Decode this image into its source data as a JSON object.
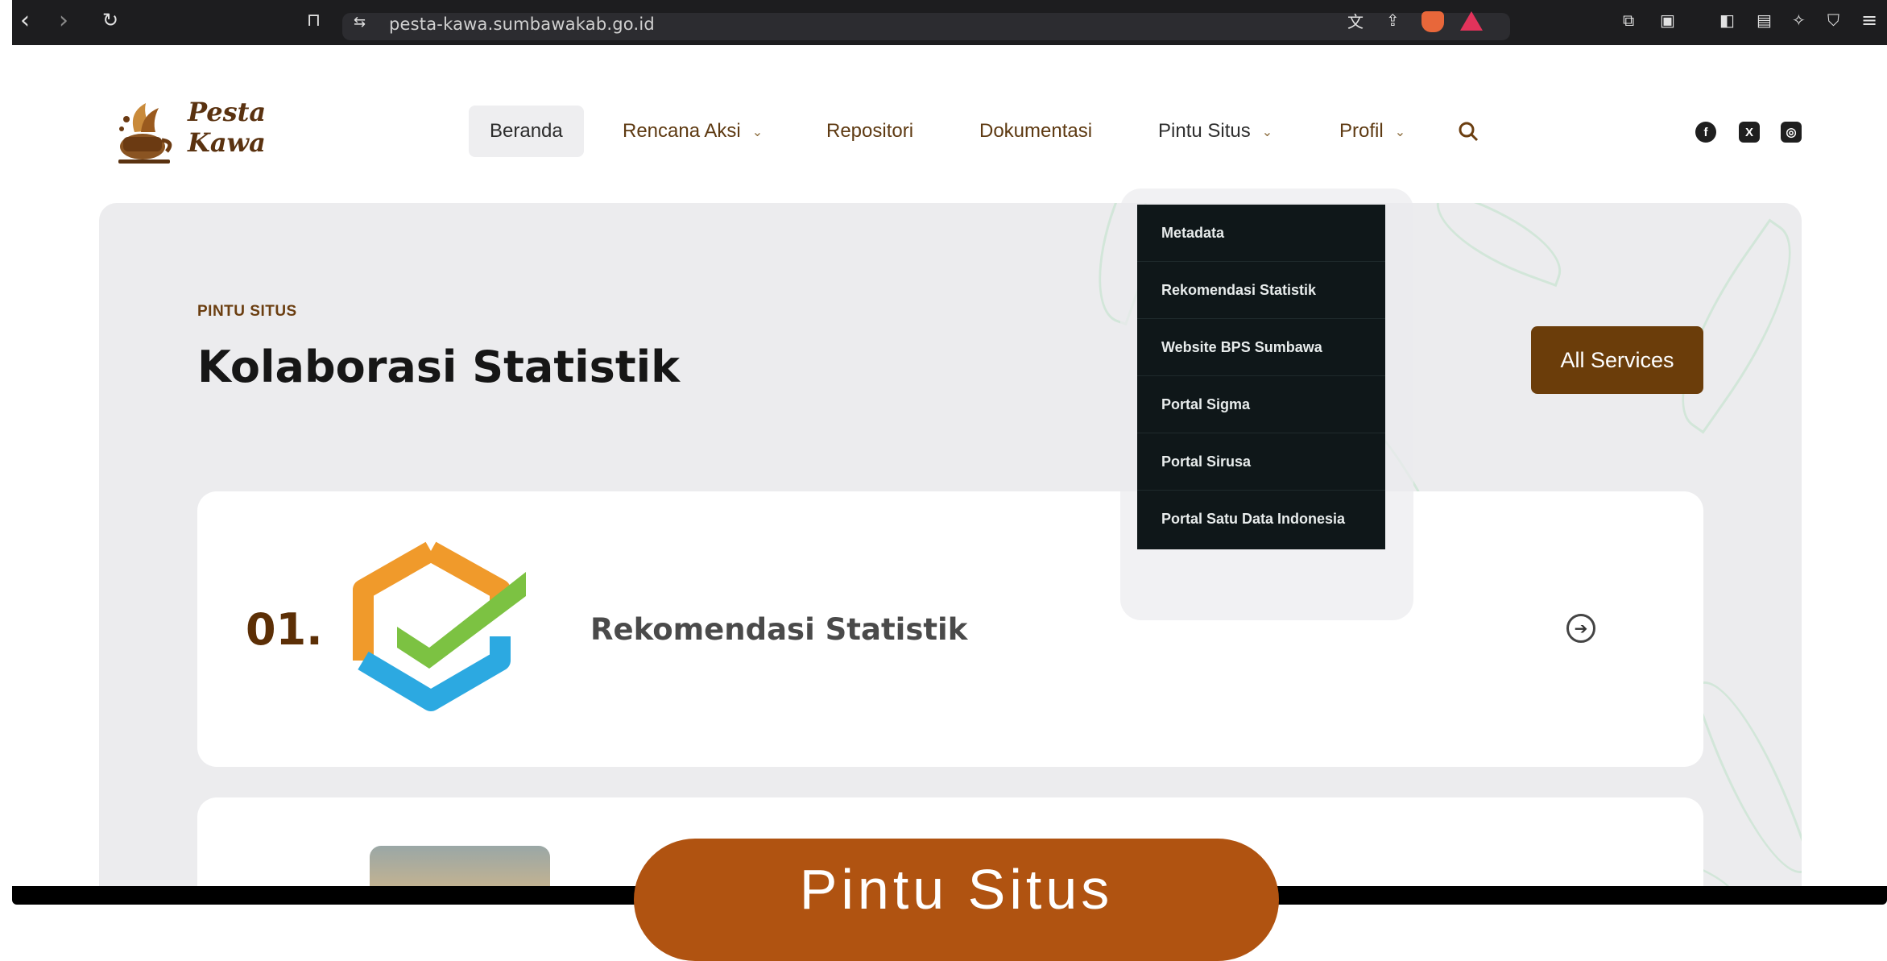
{
  "browser": {
    "url": "pesta-kawa.sumbawakab.go.id"
  },
  "site": {
    "logo_line1": "Pesta",
    "logo_line2": "Kawa",
    "nav": [
      {
        "label": "Beranda"
      },
      {
        "label": "Rencana Aksi"
      },
      {
        "label": "Repositori"
      },
      {
        "label": "Dokumentasi"
      },
      {
        "label": "Pintu Situs"
      },
      {
        "label": "Profil"
      }
    ],
    "dropdown": [
      "Metadata",
      "Rekomendasi Statistik",
      "Website BPS Sumbawa",
      "Portal Sigma",
      "Portal Sirusa",
      "Portal Satu Data Indonesia"
    ]
  },
  "hero": {
    "kicker": "PINTU SITUS",
    "title": "Kolaborasi Statistik",
    "button": "All Services"
  },
  "cards": [
    {
      "number": "01.",
      "title": "Rekomendasi Statistik"
    }
  ],
  "caption": "Pintu Situs",
  "colors": {
    "brand_brown": "#6b3d0a",
    "caption_orange": "#b05311",
    "dropdown_bg": "#0f1719"
  }
}
